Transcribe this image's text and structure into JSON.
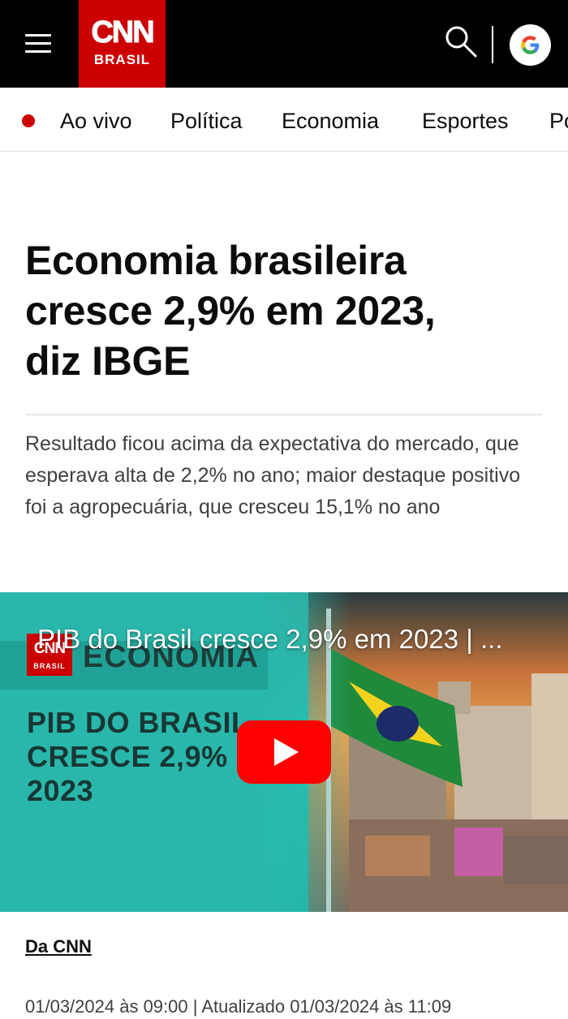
{
  "header": {
    "logo_top": "CNN",
    "logo_bottom": "BRASIL",
    "google_letter": "G"
  },
  "nav": {
    "live_label": "Ao vivo",
    "items": [
      "Política",
      "Economia",
      "Esportes",
      "Po"
    ]
  },
  "article": {
    "headline_lines": [
      "Economia brasileira",
      "cresce 2,9% em 2023,",
      "diz IBGE"
    ],
    "subtitle": "Resultado ficou acima da expectativa do mercado, que esperava alta de 2,2% no ano; maior destaque positivo foi a agropecuária, que cresceu 15,1% no ano",
    "byline": "Da CNN",
    "dateline": "01/03/2024 às 09:00 | Atualizado 01/03/2024 às 11:09"
  },
  "video": {
    "title": "PIB do Brasil cresce 2,9% em 2023 | ...",
    "logo_top": "CNN",
    "logo_bottom": "BRASIL",
    "section": "ECONOMIA",
    "thumb_lines": [
      "PIB DO BRASIL",
      "CRESCE 2,9% E",
      "2023"
    ]
  },
  "colors": {
    "brand_red": "#cc0000",
    "header_bg": "#000000",
    "play_red": "#ff0000",
    "thumb_teal": "#2fb3a9"
  },
  "icons": [
    "menu-icon",
    "search-icon",
    "google-icon",
    "play-icon",
    "live-dot-icon"
  ]
}
